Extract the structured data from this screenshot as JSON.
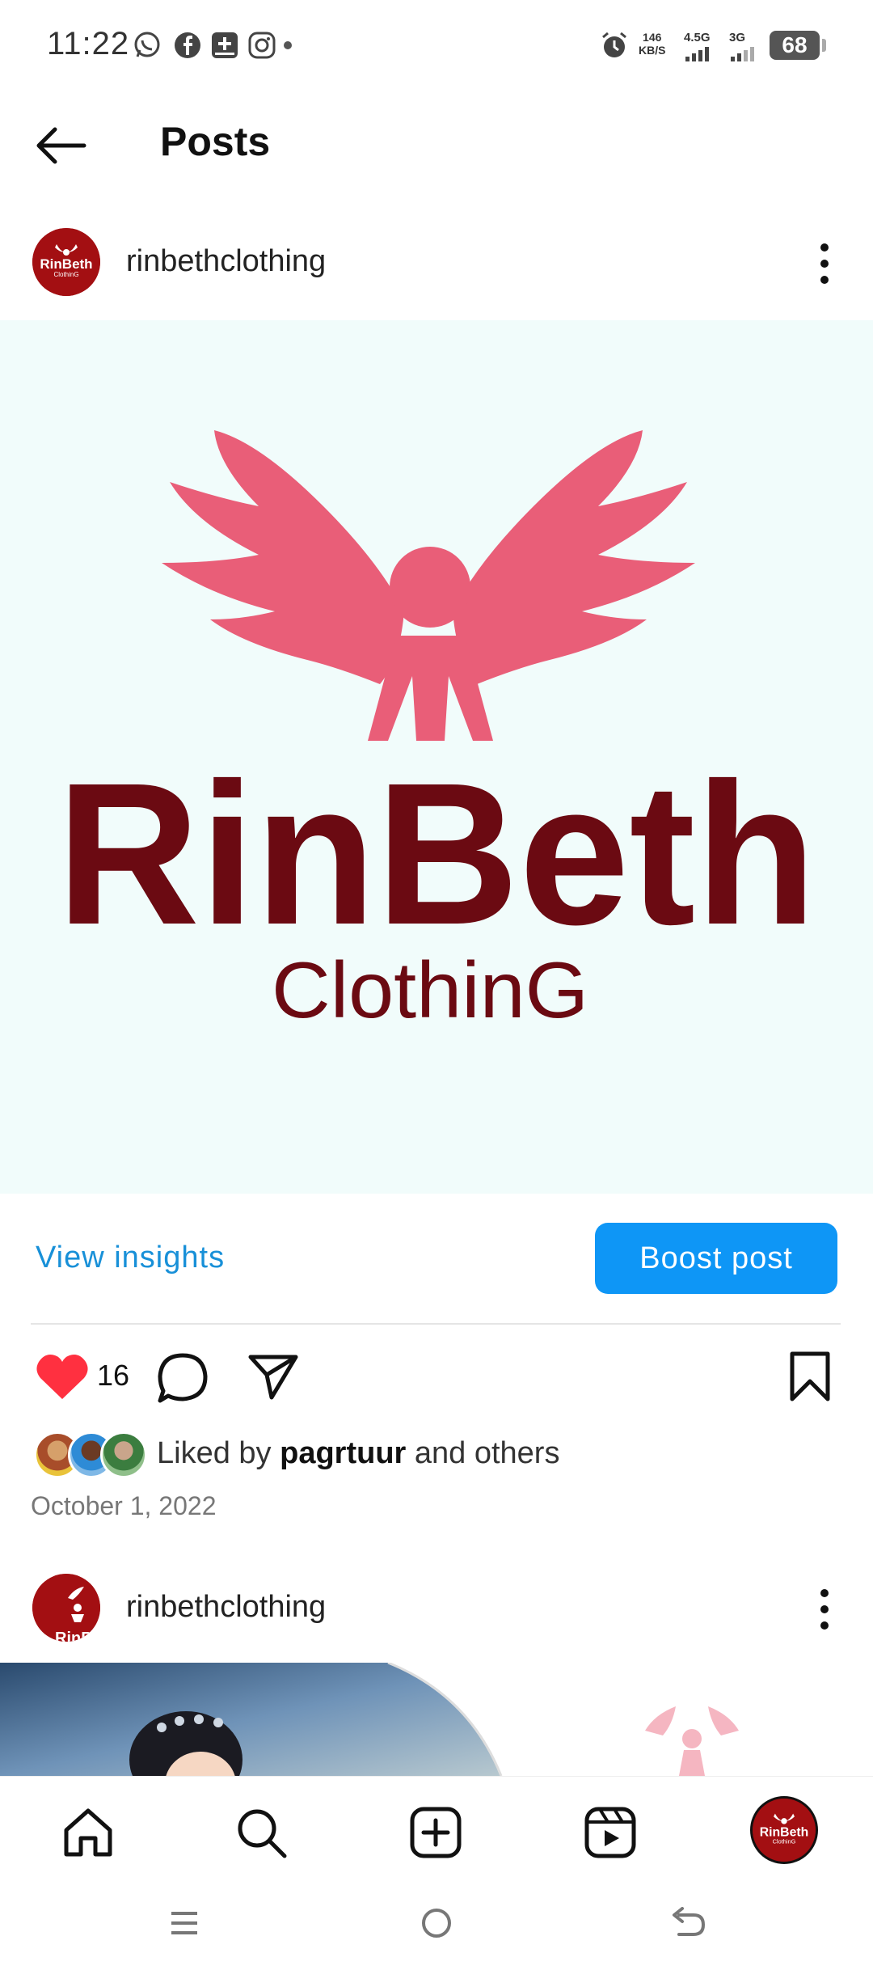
{
  "status_bar": {
    "time": "11:22",
    "net_speed_value": "146",
    "net_speed_unit": "KB/S",
    "network_1": "4.5G",
    "network_2": "3G",
    "battery": "68"
  },
  "header": {
    "title": "Posts"
  },
  "post": {
    "username": "rinbethclothing",
    "image_brand_main": "RinBeth",
    "image_brand_sub": "ClothinG",
    "avatar_text_main": "RinBeth",
    "avatar_text_sub": "ClothinG",
    "view_insights_label": "View insights",
    "boost_label": "Boost post",
    "like_count": "16",
    "liked_by_prefix": "Liked by",
    "liked_by_user": "pagrtuur",
    "liked_by_suffix": "and others",
    "date": "October 1, 2022"
  },
  "next_post": {
    "username": "rinbethclothing"
  },
  "colors": {
    "accent_blue": "#0e96f6",
    "link_blue": "#1890d8",
    "brand_maroon": "#6b0a12",
    "brand_pink": "#e95e78",
    "heart_red": "#ff3040"
  },
  "icons": {
    "back": "arrow-left-icon",
    "more": "kebab-menu-icon",
    "like": "heart-filled-icon",
    "comment": "comment-bubble-icon",
    "share": "paper-plane-icon",
    "save": "bookmark-icon",
    "nav_home": "home-icon",
    "nav_search": "search-icon",
    "nav_create": "plus-square-icon",
    "nav_reels": "reels-icon",
    "nav_profile": "profile-avatar-icon"
  }
}
